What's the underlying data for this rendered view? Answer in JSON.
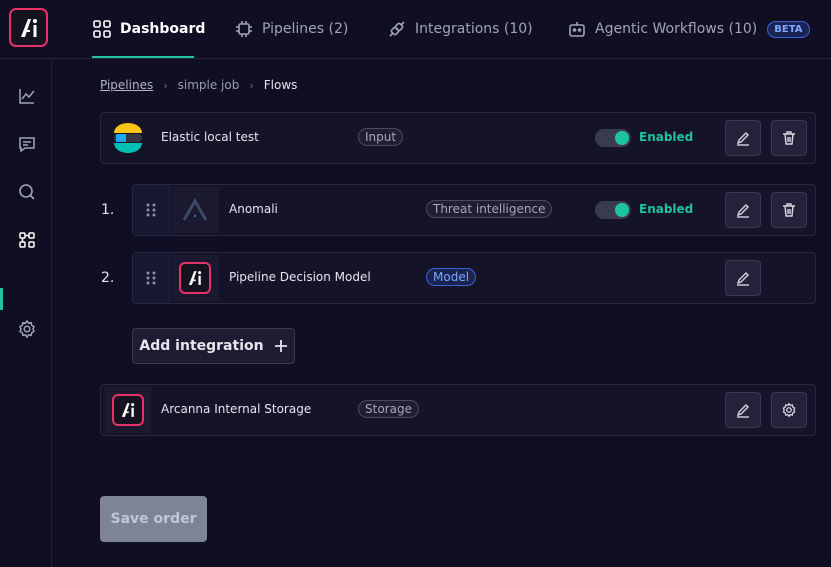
{
  "header": {
    "tabs": [
      {
        "label": "Dashboard",
        "icon": "grid-icon",
        "active": true
      },
      {
        "label": "Pipelines (2)",
        "icon": "chip-icon"
      },
      {
        "label": "Integrations (10)",
        "icon": "plug-icon"
      },
      {
        "label": "Agentic Workflows (10)",
        "icon": "robot-icon",
        "badge": "BETA"
      }
    ]
  },
  "sidebar": {
    "items": [
      {
        "icon": "chart-icon"
      },
      {
        "icon": "chat-icon"
      },
      {
        "icon": "search-icon"
      },
      {
        "icon": "flows-icon",
        "active": true
      },
      {
        "icon": "gear-icon"
      }
    ]
  },
  "breadcrumb": {
    "items": [
      "Pipelines",
      "simple job",
      "Flows"
    ]
  },
  "flows": {
    "input": {
      "title": "Elastic local test",
      "tag": "Input",
      "status": "Enabled",
      "icon": "elastic-logo-icon"
    },
    "steps": [
      {
        "number": "1.",
        "title": "Anomali",
        "tag": "Threat intelligence",
        "status": "Enabled",
        "icon": "anomali-logo-icon"
      },
      {
        "number": "2.",
        "title": "Pipeline Decision Model",
        "tag": "Model",
        "icon": "arcanna-logo-icon"
      }
    ],
    "add_label": "Add integration",
    "storage": {
      "title": "Arcanna Internal Storage",
      "tag": "Storage",
      "icon": "arcanna-logo-icon"
    }
  },
  "footer": {
    "save_label": "Save order"
  },
  "colors": {
    "accent": "#1fc49c",
    "brand": "#e8336a",
    "background": "#0f0e22"
  }
}
